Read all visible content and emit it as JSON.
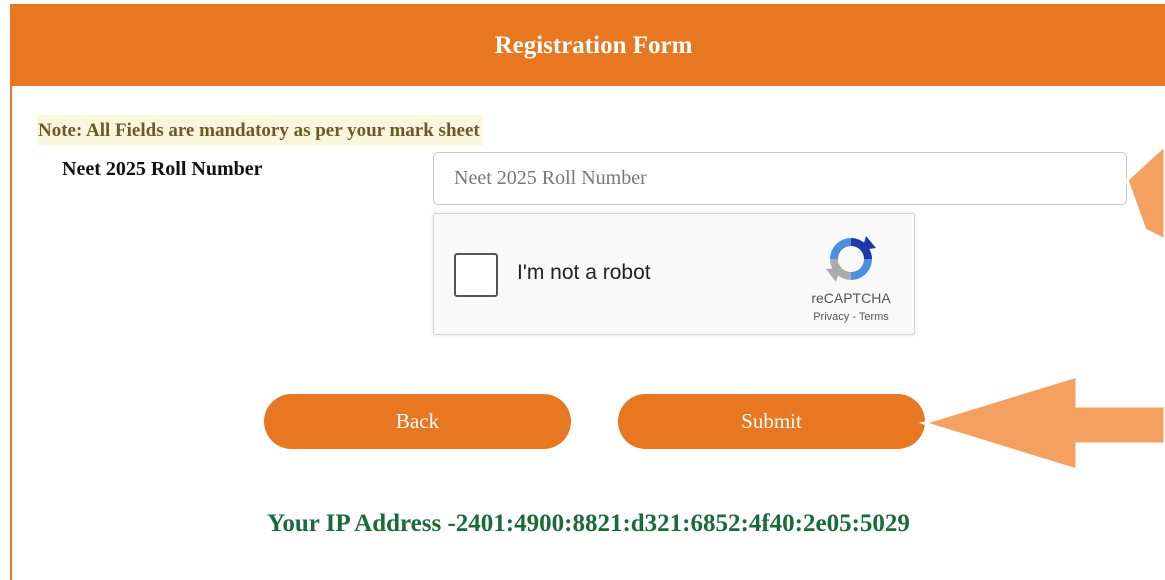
{
  "form": {
    "title": "Registration Form",
    "note": "Note: All Fields are mandatory as per your mark sheet",
    "roll_label": "Neet 2025 Roll Number",
    "roll_placeholder": "Neet 2025 Roll Number",
    "roll_value": ""
  },
  "captcha": {
    "label": "I'm not a robot",
    "brand": "reCAPTCHA",
    "privacy": "Privacy",
    "separator": "-",
    "terms": "Terms"
  },
  "buttons": {
    "back_label": "Back",
    "submit_label": "Submit"
  },
  "footer": {
    "ip_text": "Your IP Address -2401:4900:8821:d321:6852:4f40:2e05:5029"
  },
  "colors": {
    "accent": "#e87722",
    "annotation_arrow": "#f4a060",
    "ip_text": "#1b6b3a",
    "note_bg": "#fbf5dc"
  }
}
